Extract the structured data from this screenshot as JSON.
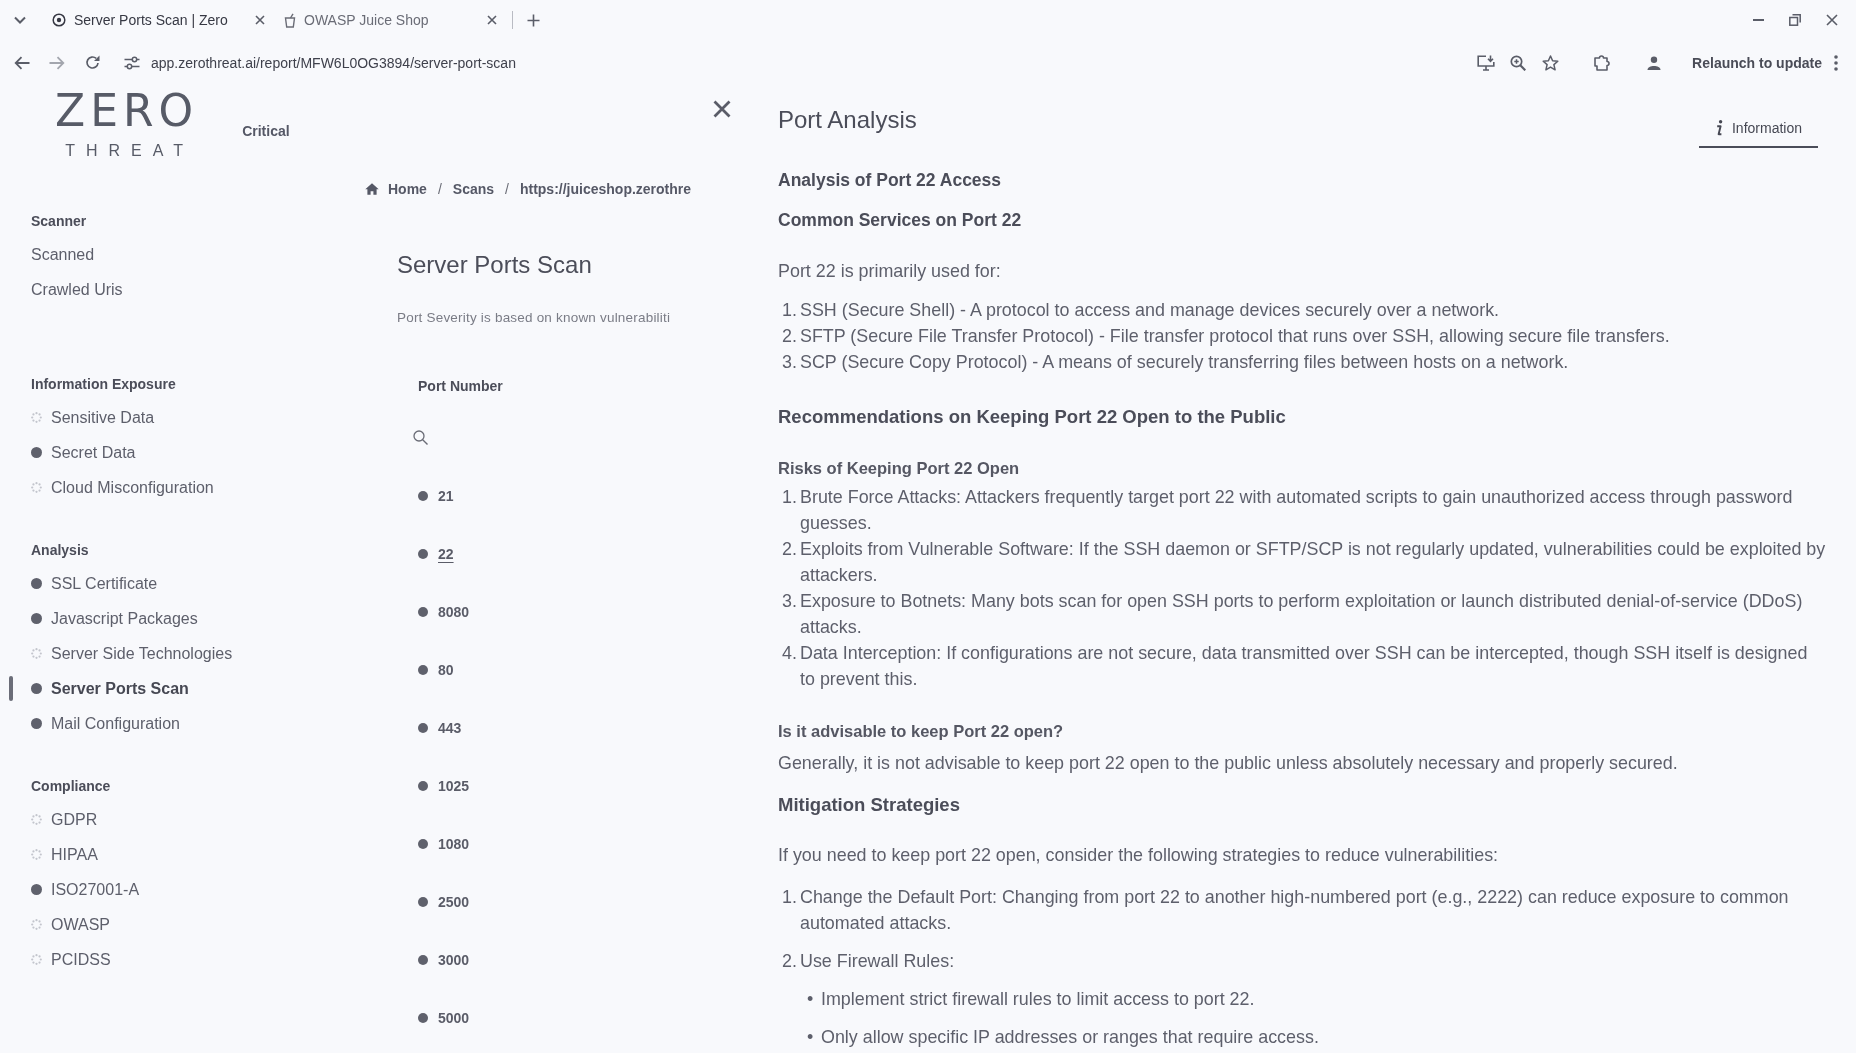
{
  "browser": {
    "tabs": [
      {
        "title": "Server Ports Scan | Zero",
        "selected": true
      },
      {
        "title": "OWASP Juice Shop",
        "selected": false
      }
    ],
    "address": "app.zerothreat.ai/report/MFW6L0OG3894/server-port-scan",
    "update_button": "Relaunch to update"
  },
  "sidebar": {
    "logo": {
      "wordmark": "ZERO",
      "tagline": "THREAT"
    },
    "severity": "Critical",
    "sections": [
      {
        "title": "Scanner",
        "items": [
          {
            "label": "Scanned",
            "kind": "plain",
            "selected": false
          },
          {
            "label": "Crawled Uris",
            "kind": "plain",
            "selected": false
          }
        ]
      },
      {
        "title": "Information Exposure",
        "items": [
          {
            "label": "Sensitive Data",
            "kind": "pending",
            "selected": false
          },
          {
            "label": "Secret Data",
            "kind": "done",
            "selected": false
          },
          {
            "label": "Cloud Misconfiguration",
            "kind": "pending",
            "selected": false
          }
        ]
      },
      {
        "title": "Analysis",
        "items": [
          {
            "label": "SSL Certificate",
            "kind": "done",
            "selected": false
          },
          {
            "label": "Javascript Packages",
            "kind": "done",
            "selected": false
          },
          {
            "label": "Server Side Technologies",
            "kind": "pending",
            "selected": false
          },
          {
            "label": "Server Ports Scan",
            "kind": "done",
            "selected": true
          },
          {
            "label": "Mail Configuration",
            "kind": "done",
            "selected": false
          }
        ]
      },
      {
        "title": "Compliance",
        "items": [
          {
            "label": "GDPR",
            "kind": "pending",
            "selected": false
          },
          {
            "label": "HIPAA",
            "kind": "pending",
            "selected": false
          },
          {
            "label": "ISO27001-A",
            "kind": "done",
            "selected": false
          },
          {
            "label": "OWASP",
            "kind": "pending",
            "selected": false
          },
          {
            "label": "PCIDSS",
            "kind": "pending",
            "selected": false
          }
        ]
      }
    ]
  },
  "scan_panel": {
    "breadcrumb": [
      {
        "label": "Home"
      },
      {
        "separator": "/",
        "label": "Scans"
      },
      {
        "separator": "/",
        "label": "https://juiceshop.zerothre"
      }
    ],
    "title": "Server Ports Scan",
    "note": "Port Severity is based on known vulnerabiliti",
    "table": {
      "column": "Port Number",
      "rows": [
        {
          "port": "21",
          "selected": false
        },
        {
          "port": "22",
          "selected": true
        },
        {
          "port": "8080",
          "selected": false
        },
        {
          "port": "80",
          "selected": false
        },
        {
          "port": "443",
          "selected": false
        },
        {
          "port": "1025",
          "selected": false
        },
        {
          "port": "1080",
          "selected": false
        },
        {
          "port": "2500",
          "selected": false
        },
        {
          "port": "3000",
          "selected": false
        },
        {
          "port": "5000",
          "selected": false
        }
      ]
    }
  },
  "port_analysis": {
    "title": "Port Analysis",
    "tabs": [
      {
        "label": "Information",
        "selected": true
      }
    ],
    "content": [
      {
        "kind": "subheading",
        "text": "Analysis of Port 22 Access"
      },
      {
        "kind": "subheading",
        "text": "Common Services on Port 22"
      },
      {
        "kind": "paragraph",
        "text": "Port 22 is primarily used for:"
      },
      {
        "kind": "list",
        "items": [
          {
            "marker": "1.",
            "text": "SSH (Secure Shell) - A protocol to access and manage devices securely over a network."
          },
          {
            "marker": "2.",
            "text": "SFTP (Secure File Transfer Protocol) - File transfer protocol that runs over SSH, allowing secure file transfers."
          },
          {
            "marker": "3.",
            "text": "SCP (Secure Copy Protocol) - A means of securely transferring files between hosts on a network."
          }
        ]
      },
      {
        "kind": "heading",
        "text": "Recommendations on Keeping Port 22 Open to the Public"
      },
      {
        "kind": "label",
        "text": "Risks of Keeping Port 22 Open"
      },
      {
        "kind": "list",
        "items": [
          {
            "marker": "1.",
            "text": "Brute Force Attacks: Attackers frequently target port 22 with automated scripts to gain unauthorized access through password guesses."
          },
          {
            "marker": "2.",
            "text": "Exploits from Vulnerable Software: If the SSH daemon or SFTP/SCP is not regularly updated, vulnerabilities could be exploited by attackers."
          },
          {
            "marker": "3.",
            "text": "Exposure to Botnets: Many bots scan for open SSH ports to perform exploitation or launch distributed denial-of-service (DDoS) attacks."
          },
          {
            "marker": "4.",
            "text": "Data Interception: If configurations are not secure, data transmitted over SSH can be intercepted, though SSH itself is designed to prevent this."
          }
        ]
      },
      {
        "kind": "label",
        "text": "Is it advisable to keep Port 22 open?"
      },
      {
        "kind": "paragraph",
        "text": "Generally, it is not advisable to keep port 22 open to the public unless absolutely necessary and properly secured."
      },
      {
        "kind": "heading",
        "text": "Mitigation Strategies"
      },
      {
        "kind": "paragraph",
        "text": "If you need to keep port 22 open, consider the following strategies to reduce vulnerabilities:"
      },
      {
        "kind": "spaced_list",
        "items": [
          {
            "marker": "1.",
            "text": "Change the Default Port: Changing from port 22 to another high-numbered port (e.g., 2222) can reduce exposure to common automated attacks."
          },
          {
            "marker": "2.",
            "text": "Use Firewall Rules:",
            "children": [
              {
                "marker": "•",
                "text": "Implement strict firewall rules to limit access to port 22."
              },
              {
                "marker": "•",
                "text": "Only allow specific IP addresses or ranges that require access."
              }
            ]
          }
        ]
      }
    ]
  }
}
